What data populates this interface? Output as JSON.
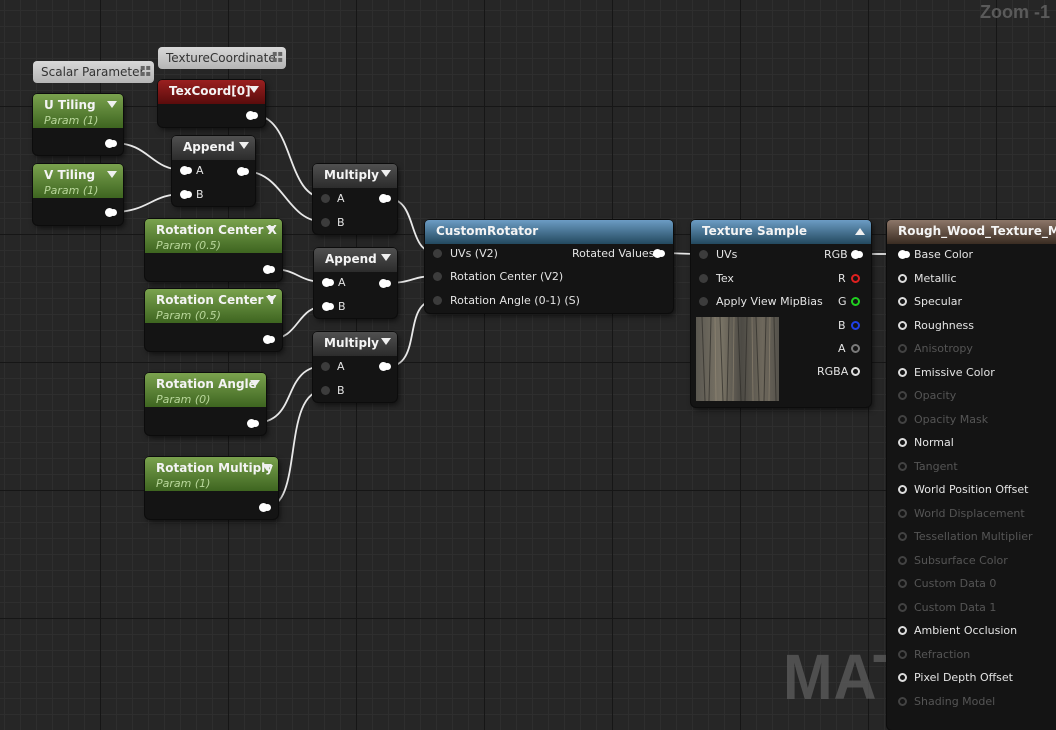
{
  "viewport": {
    "zoom_label": "Zoom -1",
    "watermark": "MATERIAL"
  },
  "comments": {
    "scalar_parameter": "Scalar Parameter",
    "texture_coordinate": "TextureCoordinate"
  },
  "nodes": {
    "u_tiling": {
      "title": "U Tiling",
      "subtitle": "Param (1)"
    },
    "v_tiling": {
      "title": "V Tiling",
      "subtitle": "Param (1)"
    },
    "texcoord": {
      "title": "TexCoord[0]"
    },
    "append_1": {
      "title": "Append",
      "pin_a": "A",
      "pin_b": "B"
    },
    "multiply_1": {
      "title": "Multiply",
      "pin_a": "A",
      "pin_b": "B"
    },
    "rotation_center_x": {
      "title": "Rotation Center X",
      "subtitle": "Param (0.5)"
    },
    "rotation_center_y": {
      "title": "Rotation Center Y",
      "subtitle": "Param (0.5)"
    },
    "append_2": {
      "title": "Append",
      "pin_a": "A",
      "pin_b": "B"
    },
    "multiply_2": {
      "title": "Multiply",
      "pin_a": "A",
      "pin_b": "B"
    },
    "rotation_angle": {
      "title": "Rotation Angle",
      "subtitle": "Param (0)"
    },
    "rotation_multiply": {
      "title": "Rotation Multiply",
      "subtitle": "Param (1)"
    },
    "custom_rotator": {
      "title": "CustomRotator",
      "inputs": [
        "UVs (V2)",
        "Rotation Center (V2)",
        "Rotation Angle (0-1) (S)"
      ],
      "output": "Rotated Values"
    },
    "texture_sample": {
      "title": "Texture Sample",
      "inputs": [
        "UVs",
        "Tex",
        "Apply View MipBias"
      ],
      "outputs": [
        "RGB",
        "R",
        "G",
        "B",
        "A",
        "RGBA"
      ],
      "preview_icon": "wood-texture-thumbnail"
    },
    "material_result": {
      "title": "Rough_Wood_Texture_Mat",
      "pins": [
        {
          "label": "Base Color",
          "active": true
        },
        {
          "label": "Metallic",
          "active": true
        },
        {
          "label": "Specular",
          "active": true
        },
        {
          "label": "Roughness",
          "active": true
        },
        {
          "label": "Anisotropy",
          "active": false
        },
        {
          "label": "Emissive Color",
          "active": true
        },
        {
          "label": "Opacity",
          "active": false
        },
        {
          "label": "Opacity Mask",
          "active": false
        },
        {
          "label": "Normal",
          "active": true
        },
        {
          "label": "Tangent",
          "active": false
        },
        {
          "label": "World Position Offset",
          "active": true
        },
        {
          "label": "World Displacement",
          "active": false
        },
        {
          "label": "Tessellation Multiplier",
          "active": false
        },
        {
          "label": "Subsurface Color",
          "active": false
        },
        {
          "label": "Custom Data 0",
          "active": false
        },
        {
          "label": "Custom Data 1",
          "active": false
        },
        {
          "label": "Ambient Occlusion",
          "active": true
        },
        {
          "label": "Refraction",
          "active": false
        },
        {
          "label": "Pixel Depth Offset",
          "active": true
        },
        {
          "label": "Shading Model",
          "active": false
        }
      ]
    }
  },
  "colors": {
    "param_header": "#4f7a2e",
    "texcoord_header": "#7a1212",
    "rotator_header": "#3c6c8c",
    "result_header": "#6e5a4c",
    "pin_red": "#e02020",
    "pin_green": "#20d020",
    "pin_blue": "#1f40e6"
  }
}
